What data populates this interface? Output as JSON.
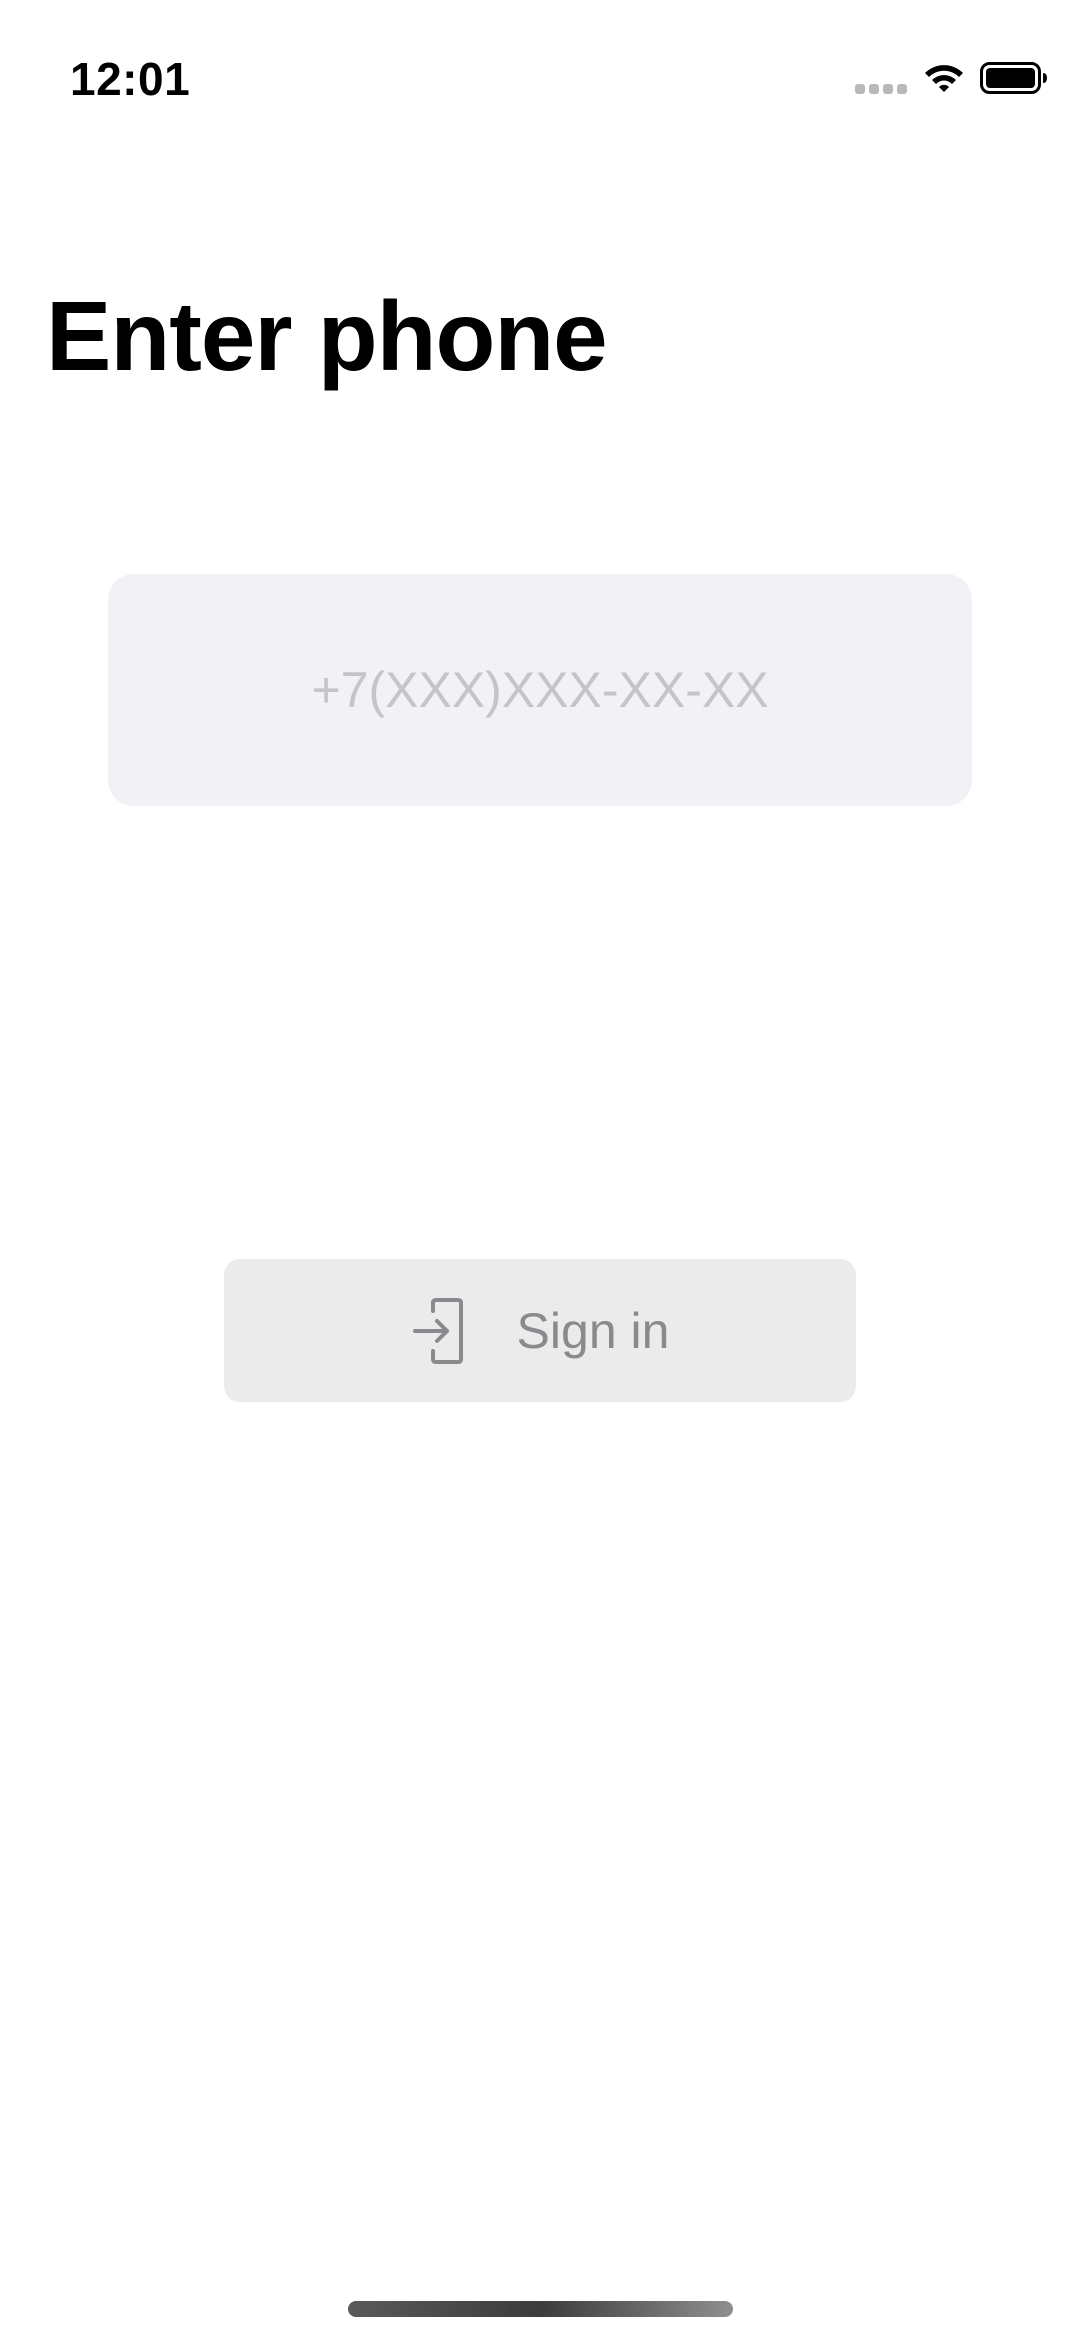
{
  "status_bar": {
    "time": "12:01",
    "icons": [
      "signal-icon",
      "wifi-icon",
      "battery-icon"
    ]
  },
  "header": {
    "title": "Enter phone"
  },
  "phone_field": {
    "value": "",
    "placeholder": "+7(XXX)XXX-XX-XX"
  },
  "signin_button": {
    "label": "Sign in",
    "icon": "sign-in-icon",
    "enabled": false
  },
  "colors": {
    "field_background": "#f2f1f6",
    "button_background": "#ebebeb",
    "button_text": "#8a8a8e",
    "placeholder_text": "#c4c4c9"
  }
}
